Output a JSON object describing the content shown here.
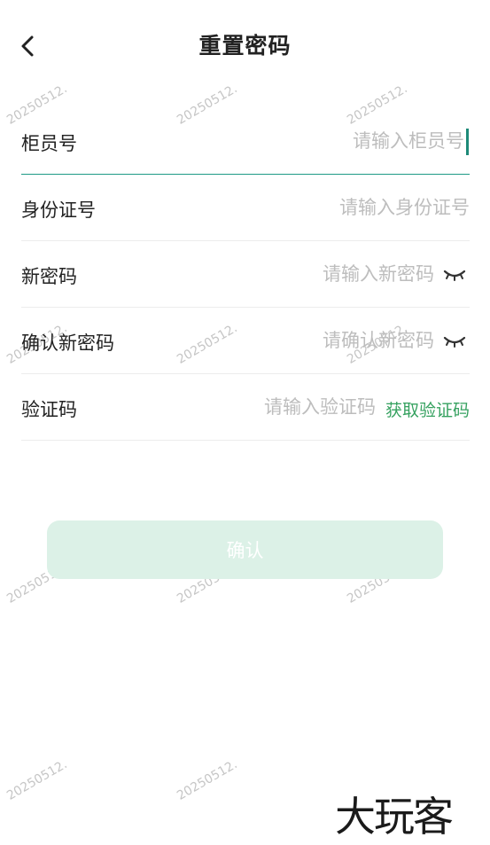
{
  "header": {
    "title": "重置密码"
  },
  "form": {
    "teller_id": {
      "label": "柜员号",
      "placeholder": "请输入柜员号"
    },
    "id_number": {
      "label": "身份证号",
      "placeholder": "请输入身份证号"
    },
    "new_password": {
      "label": "新密码",
      "placeholder": "请输入新密码"
    },
    "confirm_password": {
      "label": "确认新密码",
      "placeholder": "请确认新密码"
    },
    "verify_code": {
      "label": "验证码",
      "placeholder": "请输入验证码",
      "get_code_label": "获取验证码"
    }
  },
  "confirm_button": {
    "label": "确认"
  },
  "watermark": {
    "text": "20250512."
  },
  "brand": {
    "text": "大玩客"
  },
  "colors": {
    "accent": "#1e9a86",
    "link": "#35a15f",
    "button_bg": "#dcf1e7",
    "placeholder": "#bdbdbd"
  }
}
